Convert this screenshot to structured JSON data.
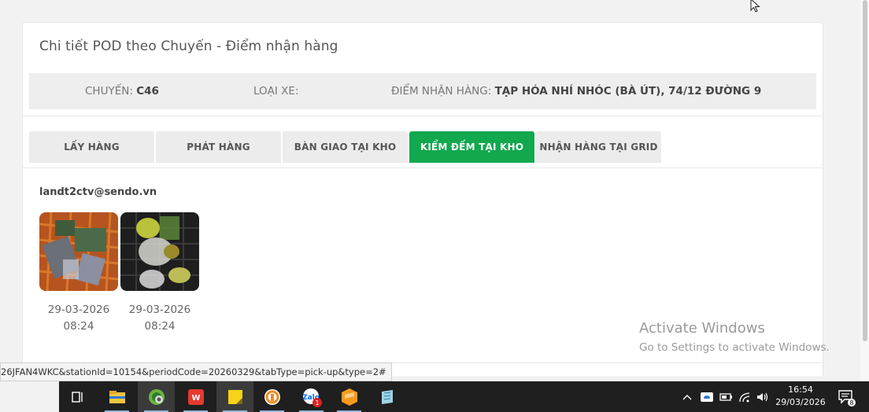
{
  "page": {
    "card_title": "Chi tiết POD theo Chuyến - Điểm nhận hàng"
  },
  "info": {
    "trip_label": "CHUYẾN:",
    "trip_value": "C46",
    "vehicle_label": "LOẠI XE:",
    "vehicle_value": "",
    "pickup_label": "ĐIỂM NHẬN HÀNG:",
    "pickup_value": "TẠP HÓA NHÍ NHÓC (BÀ ÚT), 74/12 ĐƯỜNG 9"
  },
  "tabs": [
    {
      "label": "LẤY HÀNG",
      "active": false
    },
    {
      "label": "PHÁT HÀNG",
      "active": false
    },
    {
      "label": "BÀN GIAO TẠI KHO",
      "active": false
    },
    {
      "label": "KIỂM ĐẾM TẠI KHO",
      "active": true
    },
    {
      "label": "NHẬN HÀNG TẠI GRID",
      "active": false
    }
  ],
  "pod": {
    "user": "landt2ctv@sendo.vn",
    "photos": [
      {
        "date": "29-03-2026",
        "time": "08:24"
      },
      {
        "date": "29-03-2026",
        "time": "08:24"
      }
    ]
  },
  "watermark": {
    "title": "Activate Windows",
    "subtitle": "Go to Settings to activate Windows."
  },
  "status_bar": {
    "url": "26JFAN4WKC&stationId=10154&periodCode=20260329&tabType=pick-up&type=2#"
  },
  "taskbar": {
    "apps": [
      "task-view-icon",
      "file-explorer-icon",
      "browser-icon",
      "wps-office-icon",
      "sticky-notes-icon",
      "ultraviewer-icon",
      "zalo-icon",
      "sublime-text-icon",
      "notepad-icon"
    ],
    "zalo_badge": "1",
    "time": "16:54",
    "date": "29/03/2026",
    "notification_count": "8"
  },
  "colors": {
    "active_tab": "#11a84e",
    "taskbar": "#1f1f1f"
  }
}
